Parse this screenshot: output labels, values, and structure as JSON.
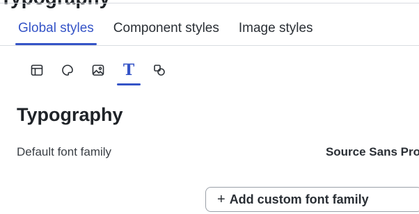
{
  "page": {
    "clipped_heading": "Typography"
  },
  "tabs": [
    {
      "label": "Global styles",
      "active": true
    },
    {
      "label": "Component styles",
      "active": false
    },
    {
      "label": "Image styles",
      "active": false
    }
  ],
  "icon_tabs": [
    {
      "icon": "layout-icon",
      "active": false
    },
    {
      "icon": "palette-icon",
      "active": false
    },
    {
      "icon": "image-icon",
      "active": false
    },
    {
      "icon": "typography-icon",
      "glyph": "T",
      "active": true
    },
    {
      "icon": "shapes-icon",
      "active": false
    }
  ],
  "section": {
    "title": "Typography"
  },
  "default_font": {
    "label": "Default font family",
    "value": "Source Sans Pro"
  },
  "add_button": {
    "plus": "+",
    "label": "Add custom font family"
  },
  "colors": {
    "accent": "#3554c7",
    "text": "#1f2328",
    "divider": "#d9dce1"
  }
}
